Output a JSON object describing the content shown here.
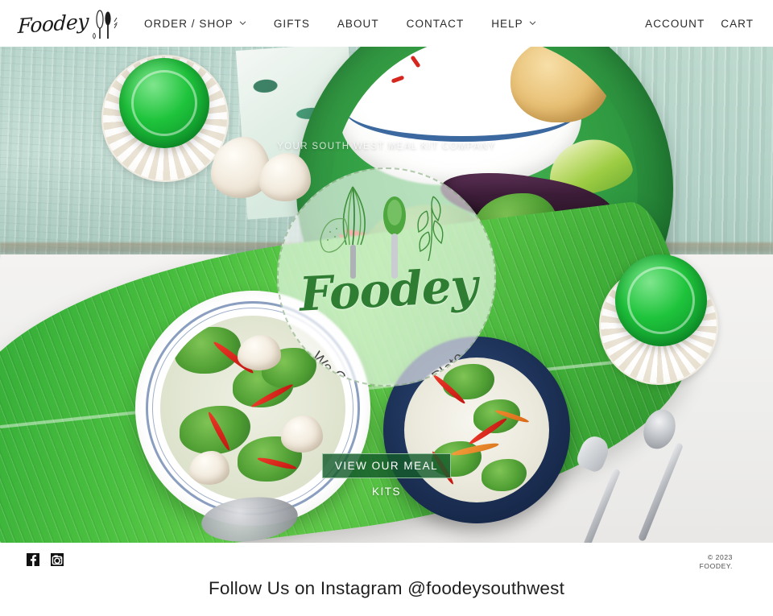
{
  "header": {
    "logo": {
      "text": "Foodey",
      "icon": "utensils-icon"
    },
    "nav": [
      {
        "label": "ORDER / SHOP",
        "has_dropdown": true
      },
      {
        "label": "GIFTS",
        "has_dropdown": false
      },
      {
        "label": "ABOUT",
        "has_dropdown": false
      },
      {
        "label": "CONTACT",
        "has_dropdown": false
      },
      {
        "label": "HELP",
        "has_dropdown": true
      }
    ],
    "account_label": "ACCOUNT",
    "cart_label": "CART"
  },
  "hero": {
    "tagline": "YOUR SOUTH WEST MEAL KIT COMPANY",
    "badge": {
      "brand": "Foodey",
      "arc_text": "We Create — You Plate",
      "icons": [
        "whisk-icon",
        "spoon-icon",
        "herb-sprig-icon",
        "lemon-icon"
      ]
    },
    "cta": {
      "line1": "VIEW OUR MEAL",
      "line2": "KITS",
      "full_label": "VIEW OUR MEAL KITS",
      "bg_color": "#155c2c",
      "border_color": "#bee1c3",
      "text_color": "#ffffff"
    }
  },
  "footer": {
    "social": [
      {
        "name": "facebook-icon",
        "label": "Facebook"
      },
      {
        "name": "instagram-icon",
        "label": "Instagram"
      }
    ],
    "copyright_line1": "© 2023",
    "copyright_line2": "FOODEY.",
    "instagram_heading": "Follow Us on Instagram @foodeysouthwest"
  },
  "theme": {
    "brand_green": "#2f7d32",
    "button_green": "#155c2c",
    "text_dark": "#2b2b2b",
    "page_bg": "#ffffff"
  }
}
